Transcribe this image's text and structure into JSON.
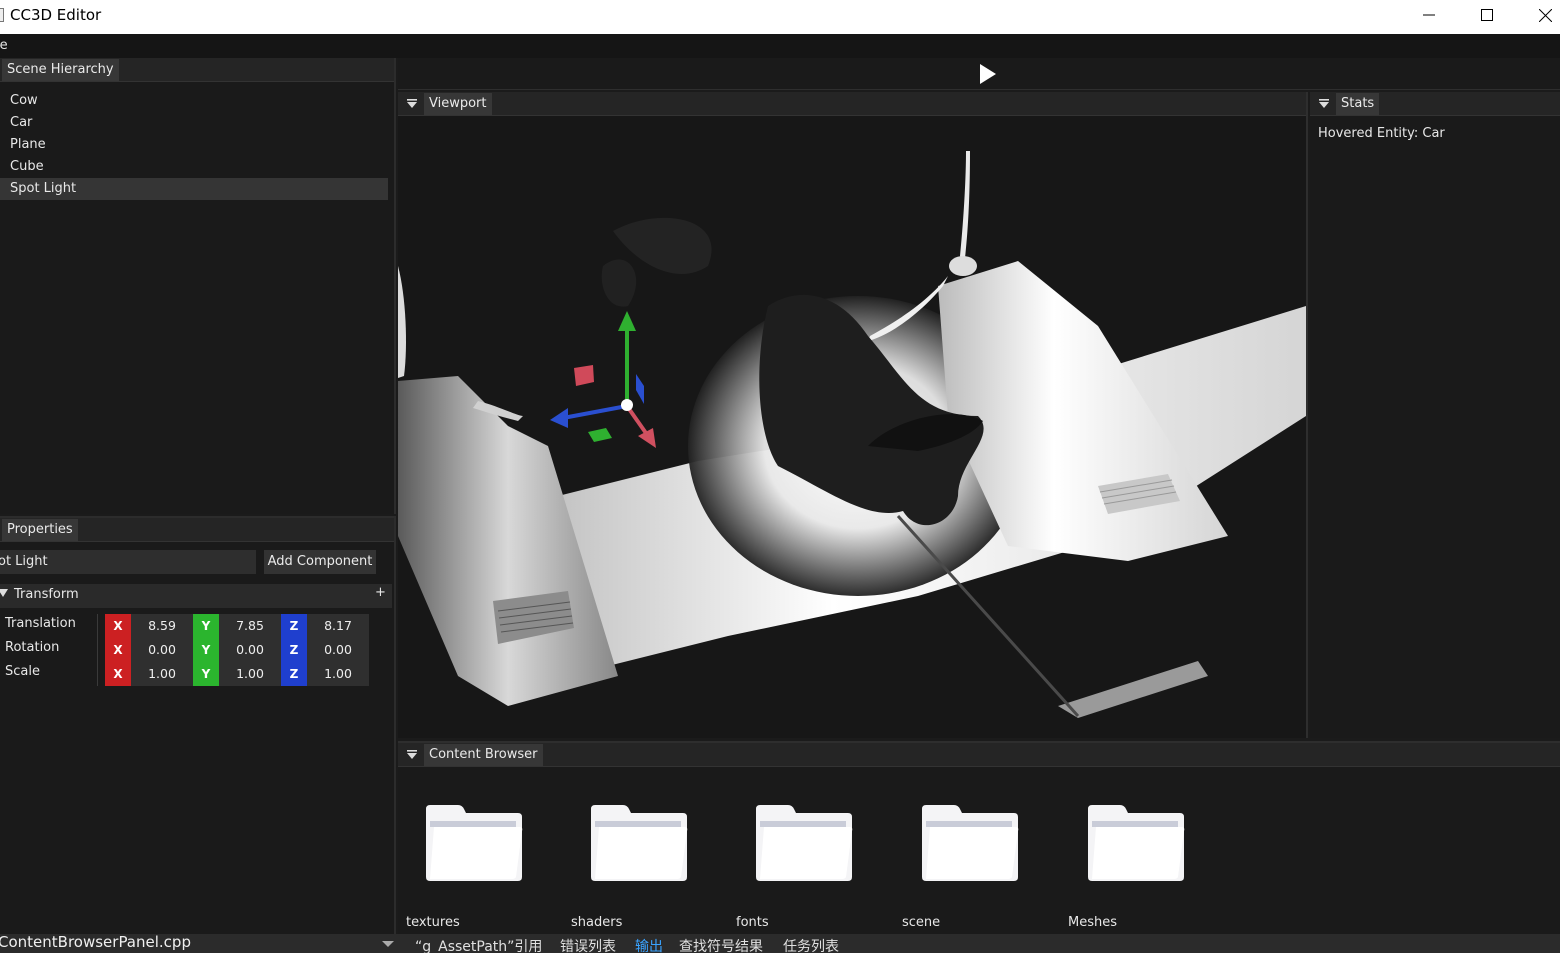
{
  "window": {
    "title": "CC3D Editor"
  },
  "menu": {
    "file": "le"
  },
  "hierarchy": {
    "tab": "Scene Hierarchy",
    "items": [
      {
        "label": "Cow",
        "selected": false
      },
      {
        "label": "Car",
        "selected": false
      },
      {
        "label": "Plane",
        "selected": false
      },
      {
        "label": "Cube",
        "selected": false
      },
      {
        "label": "Spot Light",
        "selected": true
      }
    ]
  },
  "properties": {
    "tab": "Properties",
    "entity_name": "ot Light",
    "add_component": "Add Component",
    "transform": {
      "header": "Transform",
      "plus": "+",
      "rows": [
        {
          "label": "Translation",
          "x": "8.59",
          "y": "7.85",
          "z": "8.17"
        },
        {
          "label": "Rotation",
          "x": "0.00",
          "y": "0.00",
          "z": "0.00"
        },
        {
          "label": "Scale",
          "x": "1.00",
          "y": "1.00",
          "z": "1.00"
        }
      ],
      "axis_labels": {
        "x": "X",
        "y": "Y",
        "z": "Z"
      }
    }
  },
  "viewport": {
    "tab": "Viewport"
  },
  "stats": {
    "tab": "Stats",
    "hovered": "Hovered Entity: Car"
  },
  "content_browser": {
    "tab": "Content Browser",
    "folders": [
      "textures",
      "shaders",
      "fonts",
      "scene",
      "Meshes"
    ]
  },
  "ide_bar": {
    "file": "ContentBrowserPanel.cpp",
    "tabs": [
      {
        "label": "“g_AssetPath”引用",
        "active": false
      },
      {
        "label": "错误列表",
        "active": false
      },
      {
        "label": "输出",
        "active": true
      },
      {
        "label": "查找符号结果",
        "active": false
      },
      {
        "label": "任务列表",
        "active": false
      }
    ]
  },
  "colors": {
    "axis_x": "#cc2022",
    "axis_y": "#2bb52e",
    "axis_z": "#1f3fce",
    "active_tab": "#3aa3ff"
  }
}
